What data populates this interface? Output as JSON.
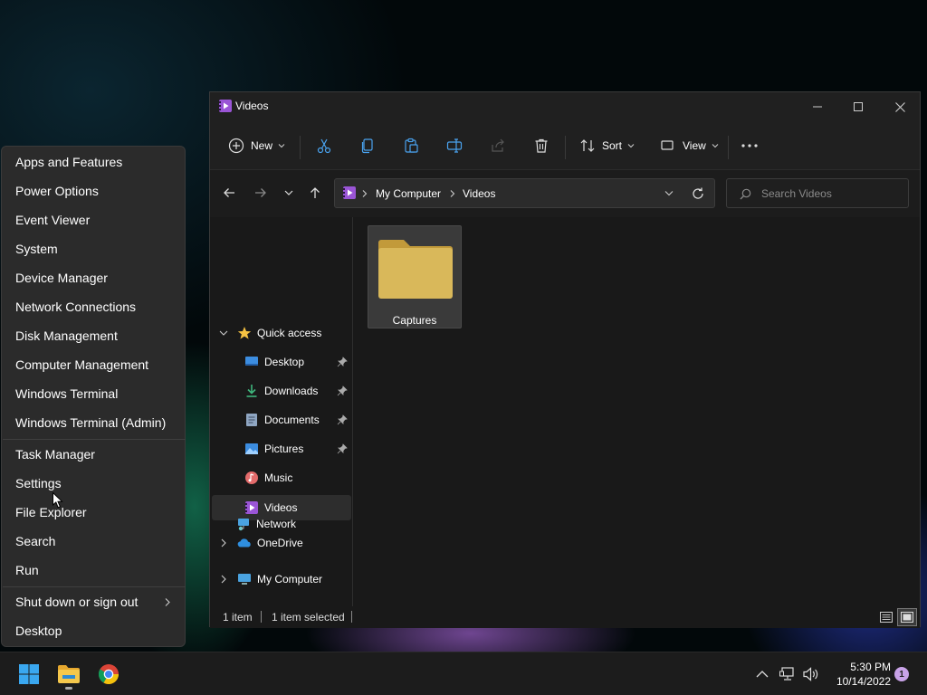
{
  "window": {
    "title": "Videos",
    "controls": {
      "minimize": "minimize",
      "maximize": "maximize",
      "close": "close"
    }
  },
  "toolbar": {
    "new_label": "New",
    "sort_label": "Sort",
    "view_label": "View",
    "icons": [
      "cut-icon",
      "copy-icon",
      "paste-icon",
      "rename-icon",
      "share-icon",
      "delete-icon",
      "more-icon"
    ]
  },
  "address": {
    "breadcrumb": [
      "My Computer",
      "Videos"
    ],
    "search_placeholder": "Search Videos"
  },
  "navpane": {
    "quick_access": "Quick access",
    "items": [
      {
        "label": "Desktop",
        "pinned": true
      },
      {
        "label": "Downloads",
        "pinned": true
      },
      {
        "label": "Documents",
        "pinned": true
      },
      {
        "label": "Pictures",
        "pinned": true
      },
      {
        "label": "Music",
        "pinned": false
      },
      {
        "label": "Videos",
        "pinned": false,
        "selected": true
      }
    ],
    "onedrive": "OneDrive",
    "my_computer": "My Computer",
    "network": "Network"
  },
  "content": {
    "folders": [
      {
        "name": "Captures"
      }
    ]
  },
  "status": {
    "count": "1 item",
    "selected": "1 item selected"
  },
  "menu": {
    "group1": [
      "Apps and Features",
      "Power Options",
      "Event Viewer",
      "System",
      "Device Manager",
      "Network Connections",
      "Disk Management",
      "Computer Management",
      "Windows Terminal",
      "Windows Terminal (Admin)"
    ],
    "group2": [
      "Task Manager",
      "Settings",
      "File Explorer",
      "Search",
      "Run"
    ],
    "group3": [
      "Shut down or sign out",
      "Desktop"
    ]
  },
  "taskbar": {
    "time": "5:30 PM",
    "date": "10/14/2022",
    "notifications": "1"
  },
  "colors": {
    "accent_folder": "#d9b85a",
    "videos_icon": "#9a55d6",
    "selected_row": "#2d2d2d"
  }
}
